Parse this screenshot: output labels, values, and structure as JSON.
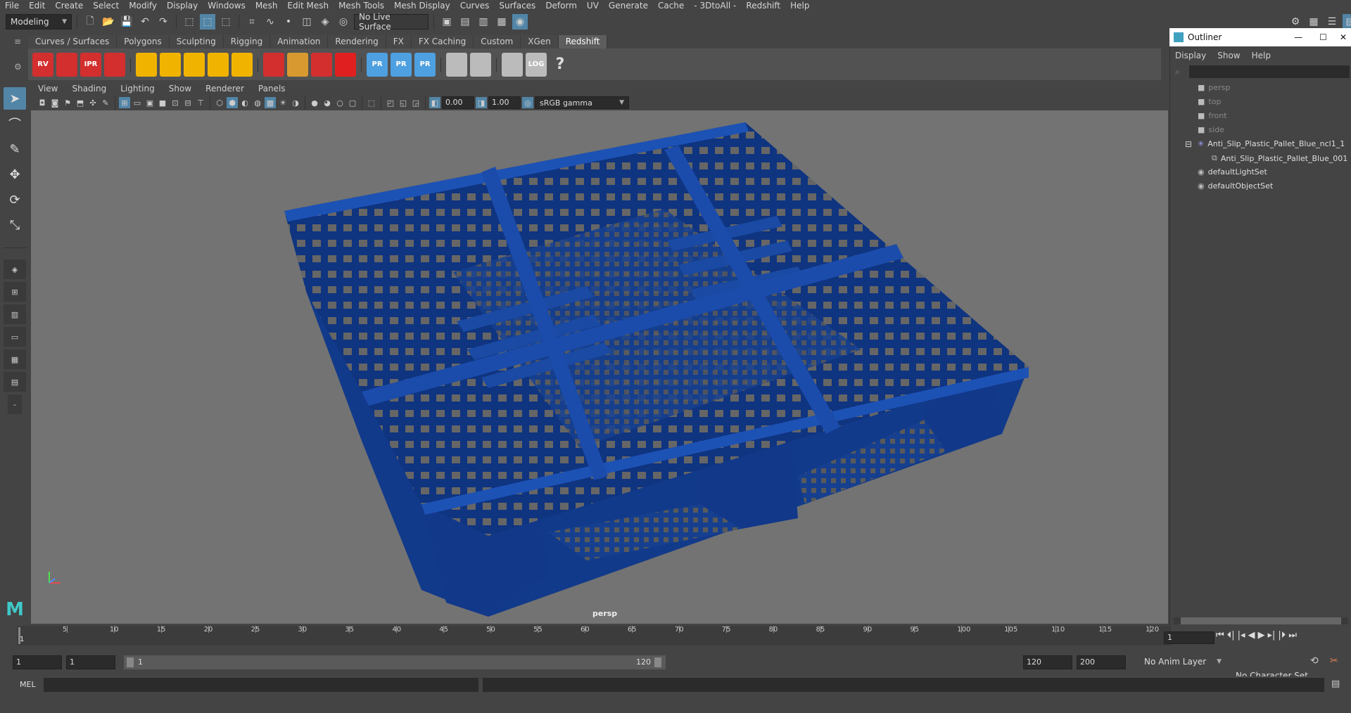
{
  "menubar": [
    "File",
    "Edit",
    "Create",
    "Select",
    "Modify",
    "Display",
    "Windows",
    "Mesh",
    "Edit Mesh",
    "Mesh Tools",
    "Mesh Display",
    "Curves",
    "Surfaces",
    "Deform",
    "UV",
    "Generate",
    "Cache",
    "- 3DtoAll -",
    "Redshift",
    "Help"
  ],
  "status": {
    "mode": "Modeling",
    "live_surface": "No Live Surface"
  },
  "shelf": {
    "tabs": [
      "Curves / Surfaces",
      "Polygons",
      "Sculpting",
      "Rigging",
      "Animation",
      "Rendering",
      "FX",
      "FX Caching",
      "Custom",
      "XGen",
      "Redshift"
    ],
    "active_tab": "Redshift",
    "icons": [
      {
        "name": "rs-render-view-icon",
        "label": "RV",
        "color": "#d32f2f"
      },
      {
        "name": "rs-batch-render-icon",
        "label": "",
        "color": "#d32f2f"
      },
      {
        "name": "rs-ipr-icon",
        "label": "IPR",
        "color": "#d32f2f"
      },
      {
        "name": "rs-settings-icon",
        "label": "",
        "color": "#d32f2f"
      },
      {
        "name": "rs-light-icon",
        "label": "",
        "color": "#f0b400"
      },
      {
        "name": "rs-area-light-icon",
        "label": "",
        "color": "#f0b400"
      },
      {
        "name": "rs-spot-light-icon",
        "label": "",
        "color": "#f0b400"
      },
      {
        "name": "rs-dome-light-icon",
        "label": "",
        "color": "#f0b400"
      },
      {
        "name": "rs-sun-sky-icon",
        "label": "",
        "color": "#f0b400"
      },
      {
        "name": "rs-volume-icon",
        "label": "",
        "color": "#d32f2f"
      },
      {
        "name": "rs-hair-icon",
        "label": "",
        "color": "#d89a30"
      },
      {
        "name": "rs-curve-icon",
        "label": "",
        "color": "#d32f2f"
      },
      {
        "name": "rs-sphere-icon",
        "label": "",
        "color": "#e02020"
      },
      {
        "name": "rs-proxy-icon",
        "label": "PR",
        "color": "#4ea0e0"
      },
      {
        "name": "rs-proxy-export-icon",
        "label": "PR",
        "color": "#4ea0e0"
      },
      {
        "name": "rs-proxy-import-icon",
        "label": "PR",
        "color": "#4ea0e0"
      },
      {
        "name": "rs-material-icon",
        "label": "",
        "color": "#bbbbbb"
      },
      {
        "name": "rs-material-2-icon",
        "label": "",
        "color": "#bbbbbb"
      },
      {
        "name": "rs-script-icon",
        "label": "",
        "color": "#bbbbbb"
      },
      {
        "name": "rs-log-icon",
        "label": "LOG",
        "color": "#bbbbbb"
      },
      {
        "name": "rs-help-icon",
        "label": "?",
        "color": "#dddddd"
      }
    ]
  },
  "viewport": {
    "menu": [
      "View",
      "Shading",
      "Lighting",
      "Show",
      "Renderer",
      "Panels"
    ],
    "exposure": "0.00",
    "gamma": "1.00",
    "color_space": "sRGB gamma",
    "camera": "persp",
    "model_color": "#1a4aa3"
  },
  "outliner": {
    "title": "Outliner",
    "menu": [
      "Display",
      "Show",
      "Help"
    ],
    "items": [
      {
        "label": "persp",
        "icon": "camera-icon",
        "dim": true,
        "indent": 0
      },
      {
        "label": "top",
        "icon": "camera-icon",
        "dim": true,
        "indent": 0
      },
      {
        "label": "front",
        "icon": "camera-icon",
        "dim": true,
        "indent": 0
      },
      {
        "label": "side",
        "icon": "camera-icon",
        "dim": true,
        "indent": 0
      },
      {
        "label": "Anti_Slip_Plastic_Pallet_Blue_ncl1_1",
        "icon": "group-icon",
        "dim": false,
        "indent": 0
      },
      {
        "label": "Anti_Slip_Plastic_Pallet_Blue_001",
        "icon": "mesh-icon",
        "dim": false,
        "indent": 1
      },
      {
        "label": "defaultLightSet",
        "icon": "set-icon",
        "dim": false,
        "indent": 0
      },
      {
        "label": "defaultObjectSet",
        "icon": "set-icon",
        "dim": false,
        "indent": 0
      }
    ]
  },
  "timeline": {
    "ticks": [
      "5",
      "10",
      "15",
      "20",
      "25",
      "30",
      "35",
      "40",
      "45",
      "50",
      "55",
      "60",
      "65",
      "70",
      "75",
      "80",
      "85",
      "90",
      "95",
      "100",
      "105",
      "110",
      "115",
      "120"
    ],
    "first_tick": "1",
    "current_frame": "1"
  },
  "range": {
    "start": "1",
    "start2": "1",
    "slider_start": "1",
    "slider_end": "120",
    "end": "120",
    "end2": "200",
    "anim_layer": "No Anim Layer",
    "char_set": "No Character Set"
  },
  "cmdline": {
    "lang": "MEL"
  }
}
